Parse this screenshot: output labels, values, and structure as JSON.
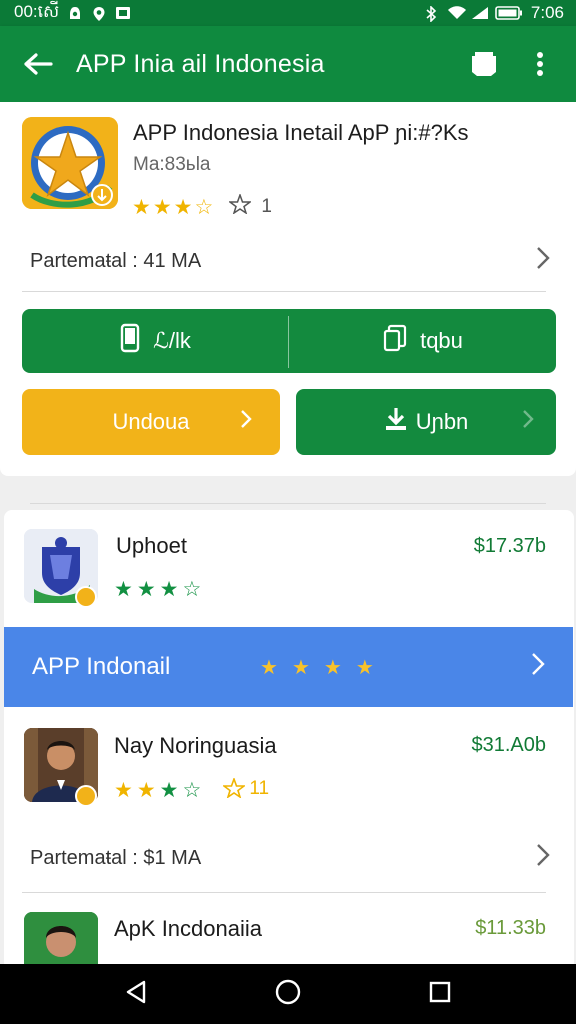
{
  "status_bar": {
    "time": "00:សើ",
    "clock": "7:06"
  },
  "app_bar": {
    "title": "APP Inia ail Indonesia",
    "icons": [
      "back-arrow-icon",
      "bookmark-icon",
      "more-vert-icon"
    ]
  },
  "app_header": {
    "title": "APP Indonesia Inetail ApP ɲi:#?Ks",
    "subtitle": "Ma:83ьla",
    "stars": [
      "★",
      "★",
      "★",
      "☆"
    ],
    "rating_count": "1",
    "info_label": "Partemaŧal : 41 MA"
  },
  "actions": {
    "left_label": "ℒ/lk",
    "right_label": "tɋbu",
    "secondary_left": "Undoua",
    "secondary_right": "Uɲbn"
  },
  "list": {
    "items": [
      {
        "name": "Uphoet",
        "price": "$17.37b",
        "stars": [
          "★",
          "★",
          "★",
          "☆"
        ]
      },
      {
        "name": "Nay Noringuasia",
        "price": "$31.A0b",
        "stars": [
          "★",
          "★",
          "★",
          "☆"
        ],
        "rating_count": "11",
        "info_label": "Partemaŧal : $1 MA"
      },
      {
        "name": "ApK Incdonaiia",
        "price": "$11.33b"
      }
    ],
    "highlight": {
      "title": "APP Indonail",
      "stars": [
        "★",
        "★",
        "★",
        "★"
      ]
    }
  },
  "nav_bar": {
    "icons": [
      "nav-back-icon",
      "nav-home-icon",
      "nav-recents-icon"
    ]
  },
  "colors": {
    "primary_green": "#0f8a3f",
    "accent_yellow": "#f2b319",
    "highlight_blue": "#4a86e8"
  }
}
